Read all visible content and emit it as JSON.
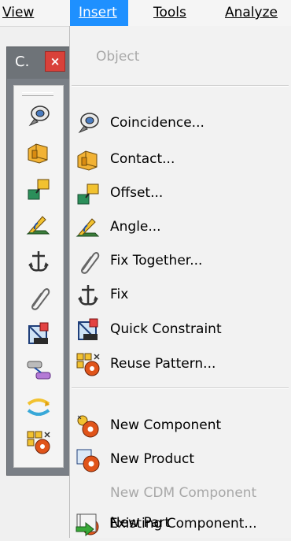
{
  "menubar": {
    "items": [
      {
        "label": "View",
        "key": "V"
      },
      {
        "label": "Insert",
        "key": "I"
      },
      {
        "label": "Tools",
        "key": "T"
      },
      {
        "label": "Analyze",
        "key": "A"
      }
    ],
    "active": "Insert",
    "active_color": "#1e90ff"
  },
  "toolbar": {
    "title": "C.",
    "close_label": "×",
    "icons": [
      "coincidence-icon",
      "contact-icon",
      "offset-icon",
      "angle-icon",
      "anchor-icon",
      "fix-together-icon",
      "quick-constraint-icon",
      "flexible-rigid-icon",
      "change-constraint-icon",
      "reuse-pattern-icon"
    ]
  },
  "dropdown": {
    "object": {
      "label": "Object",
      "mnemonic": "O",
      "enabled": false
    },
    "constraints": [
      {
        "label": "Coincidence...",
        "mnemonic": "C",
        "icon": "coincidence-icon"
      },
      {
        "label": "Contact...",
        "mnemonic": "n",
        "icon": "contact-icon"
      },
      {
        "label": "Offset...",
        "mnemonic": "f",
        "icon": "offset-icon"
      },
      {
        "label": "Angle...",
        "mnemonic": "A",
        "icon": "angle-icon"
      },
      {
        "label": "Fix Together...",
        "mnemonic": "i",
        "icon": "fix-together-icon"
      },
      {
        "label": "Fix",
        "mnemonic": "x",
        "icon": "fix-icon"
      },
      {
        "label": "Quick Constraint",
        "mnemonic": "Q",
        "icon": "quick-constraint-icon"
      },
      {
        "label": "Reuse Pattern...",
        "mnemonic": "R",
        "icon": "reuse-pattern-icon"
      }
    ],
    "components": [
      {
        "label": "New Component",
        "mnemonic": "e",
        "icon": "new-component-icon",
        "enabled": true
      },
      {
        "label": "New Product",
        "mnemonic": "w",
        "icon": "new-product-icon",
        "enabled": true
      },
      {
        "label": "New CDM Component",
        "mnemonic": "D",
        "icon": "",
        "enabled": false
      },
      {
        "label": "New Part",
        "mnemonic": "P",
        "icon": "new-part-icon",
        "enabled": true
      },
      {
        "label": "Existing Component...",
        "mnemonic": "s",
        "icon": "existing-component-icon",
        "enabled": true
      }
    ]
  }
}
